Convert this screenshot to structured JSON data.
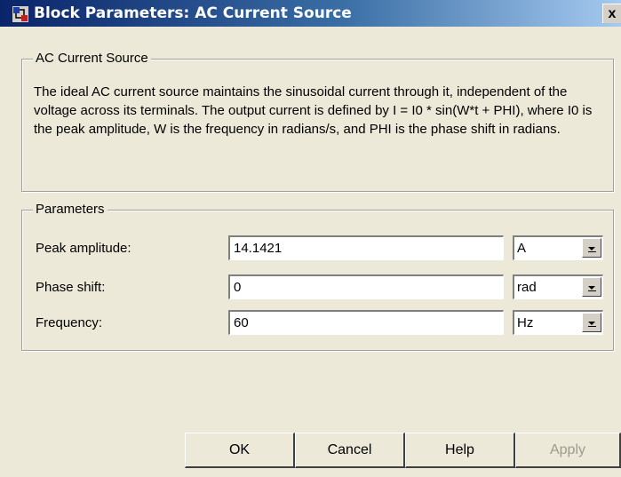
{
  "window": {
    "title": "Block Parameters: AC Current Source",
    "close_label": "x"
  },
  "description_group": {
    "legend": "AC Current Source",
    "text": "The ideal AC current source maintains the sinusoidal current through it, independent of the voltage across its terminals. The output current is defined by I = I0 * sin(W*t + PHI), where I0 is the peak amplitude, W is the frequency in radians/s, and PHI is the phase shift in radians."
  },
  "parameters_group": {
    "legend": "Parameters",
    "rows": [
      {
        "label": "Peak amplitude:",
        "value": "14.1421",
        "unit": "A"
      },
      {
        "label": "Phase shift:",
        "value": "0",
        "unit": "rad"
      },
      {
        "label": "Frequency:",
        "value": "60",
        "unit": "Hz"
      }
    ]
  },
  "buttons": {
    "ok": "OK",
    "cancel": "Cancel",
    "help": "Help",
    "apply": "Apply"
  }
}
